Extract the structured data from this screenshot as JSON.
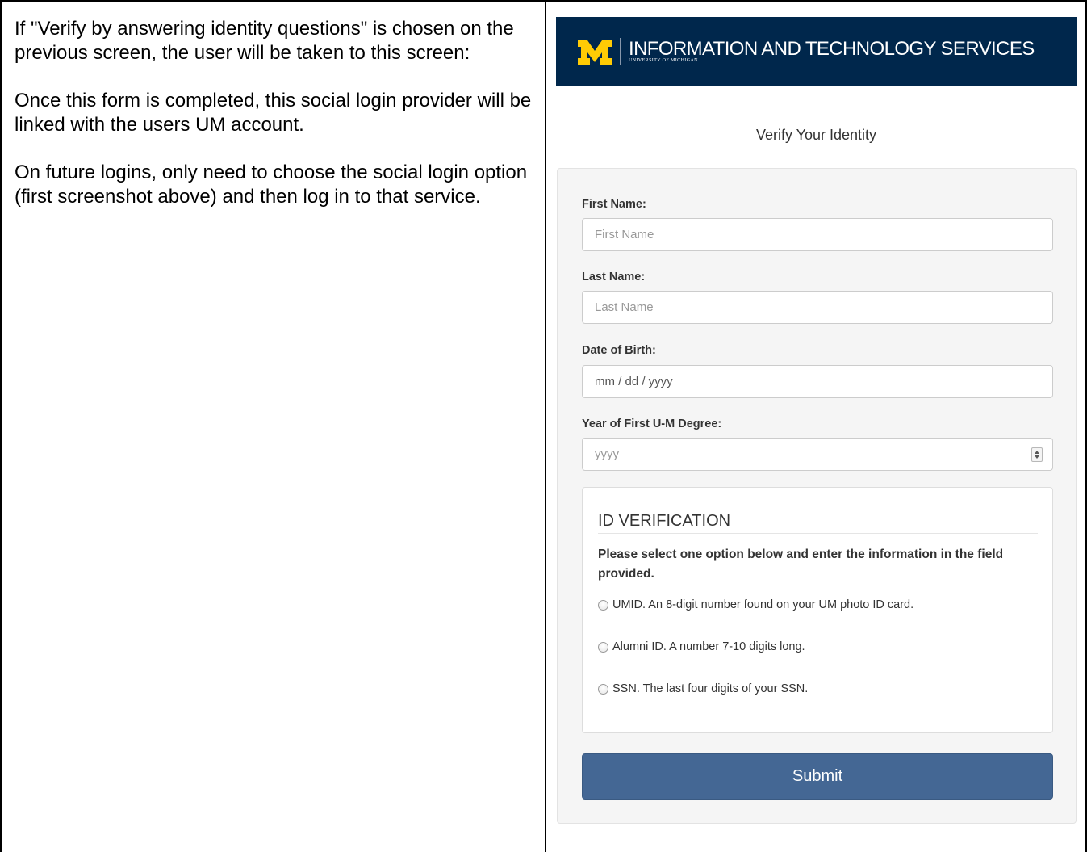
{
  "left": {
    "paragraphs": [
      "If  \"Verify by answering identity questions\" is chosen on the previous screen, the user will be taken to this screen:",
      "Once this form is completed, this social login provider will be linked with the users UM account.",
      "On future logins, only need to choose the social login option (first screenshot above) and then log in to that service."
    ]
  },
  "header": {
    "title": "INFORMATION AND TECHNOLOGY SERVICES",
    "subtitle": "UNIVERSITY OF MICHIGAN",
    "logo_icon": "block-m-logo",
    "bg_color": "#00274c",
    "logo_color": "#ffcb05"
  },
  "form": {
    "title": "Verify Your Identity",
    "first_name": {
      "label": "First Name:",
      "placeholder": "First Name"
    },
    "last_name": {
      "label": "Last Name:",
      "placeholder": "Last Name"
    },
    "dob": {
      "label": "Date of Birth:",
      "placeholder": "mm / dd / yyyy"
    },
    "degree_year": {
      "label": "Year of First U-M Degree:",
      "placeholder": "yyyy"
    },
    "id_verification": {
      "legend": "ID VERIFICATION",
      "instructions": "Please select one option below and enter the information in the field provided.",
      "options": [
        "UMID. An 8-digit number found on your UM photo ID card.",
        "Alumni ID. A number 7-10 digits long.",
        "SSN. The last four digits of your SSN."
      ]
    },
    "submit_label": "Submit",
    "submit_color": "#446794"
  }
}
